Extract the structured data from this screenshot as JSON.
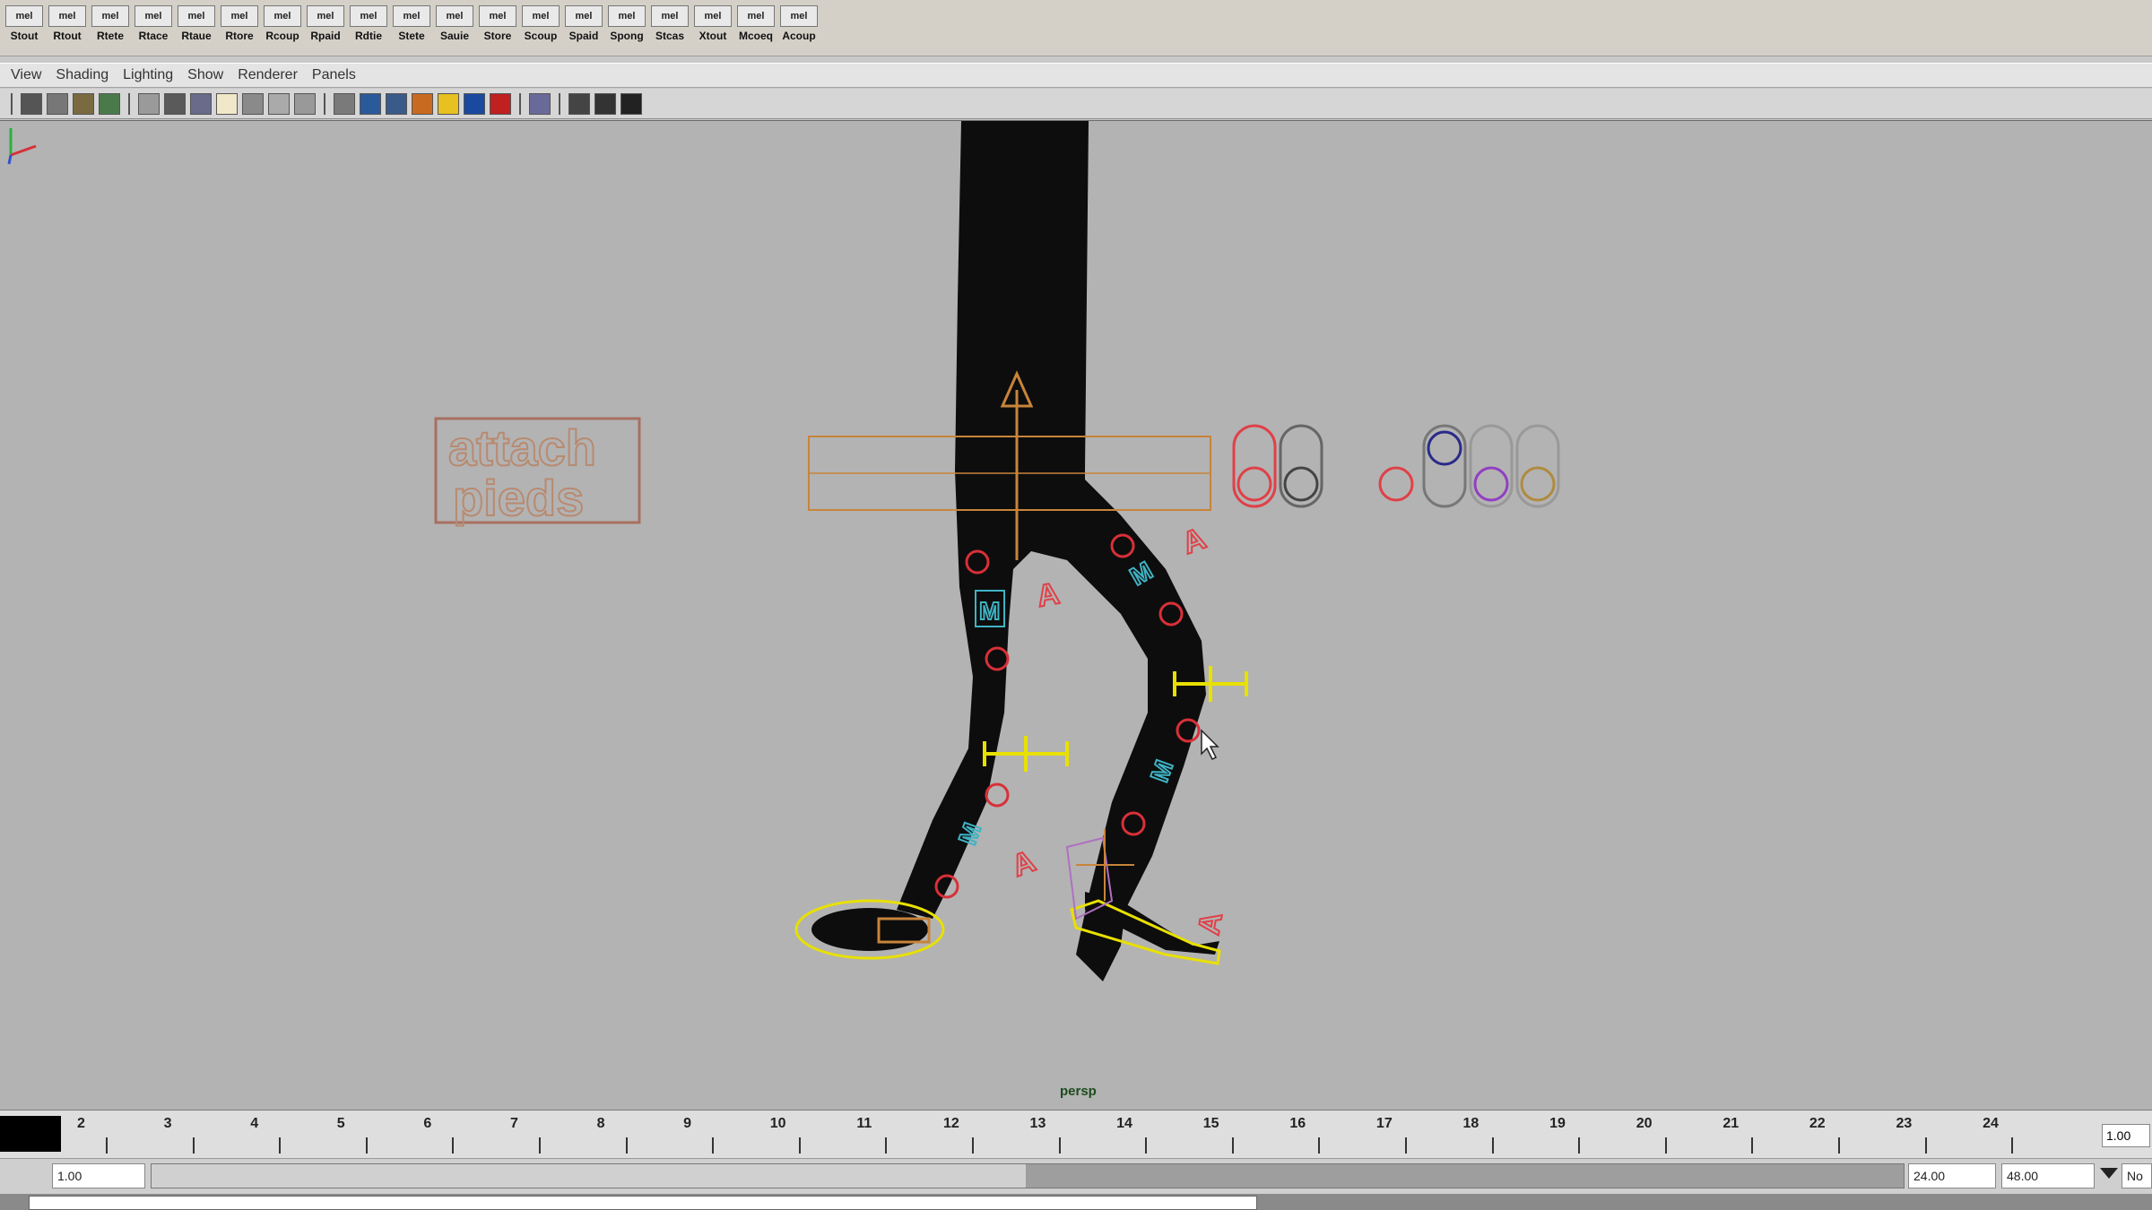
{
  "shelf": {
    "buttons": [
      {
        "icon": "mel",
        "label": "Stout"
      },
      {
        "icon": "mel",
        "label": "Rtout"
      },
      {
        "icon": "mel",
        "label": "Rtete"
      },
      {
        "icon": "mel",
        "label": "Rtace"
      },
      {
        "icon": "mel",
        "label": "Rtaue"
      },
      {
        "icon": "mel",
        "label": "Rtore"
      },
      {
        "icon": "mel",
        "label": "Rcoup"
      },
      {
        "icon": "mel",
        "label": "Rpaid"
      },
      {
        "icon": "mel",
        "label": "Rdtie"
      },
      {
        "icon": "mel",
        "label": "Stete"
      },
      {
        "icon": "mel",
        "label": "Sauie"
      },
      {
        "icon": "mel",
        "label": "Store"
      },
      {
        "icon": "mel",
        "label": "Scoup"
      },
      {
        "icon": "mel",
        "label": "Spaid"
      },
      {
        "icon": "mel",
        "label": "Spong"
      },
      {
        "icon": "mel",
        "label": "Stcas"
      },
      {
        "icon": "mel",
        "label": "Xtout"
      },
      {
        "icon": "mel",
        "label": "Mcoeq"
      },
      {
        "icon": "mel",
        "label": "Acoup"
      }
    ]
  },
  "menubar": {
    "items": [
      "View",
      "Shading",
      "Lighting",
      "Show",
      "Renderer",
      "Panels"
    ]
  },
  "viewport": {
    "camera": "persp",
    "sign_line1": "attach",
    "sign_line2": "pieds",
    "ctrl_letter_m": "M",
    "ctrl_letter_a": "A"
  },
  "timeslider": {
    "frames": [
      "2",
      "3",
      "4",
      "5",
      "6",
      "7",
      "8",
      "9",
      "10",
      "11",
      "12",
      "13",
      "14",
      "15",
      "16",
      "17",
      "18",
      "19",
      "20",
      "21",
      "22",
      "23",
      "24"
    ],
    "current_time": "1.00"
  },
  "rangeslider": {
    "start": "1.00",
    "range_end": "24.00",
    "end": "48.00",
    "option_label": "No"
  },
  "colors": {
    "viewport_bg": "#b3b3b3",
    "character": "#0d0d0d",
    "control_yellow": "#e8e000",
    "control_orange": "#c8843a",
    "control_red": "#d83038",
    "control_cyan": "#3fb3c4"
  }
}
